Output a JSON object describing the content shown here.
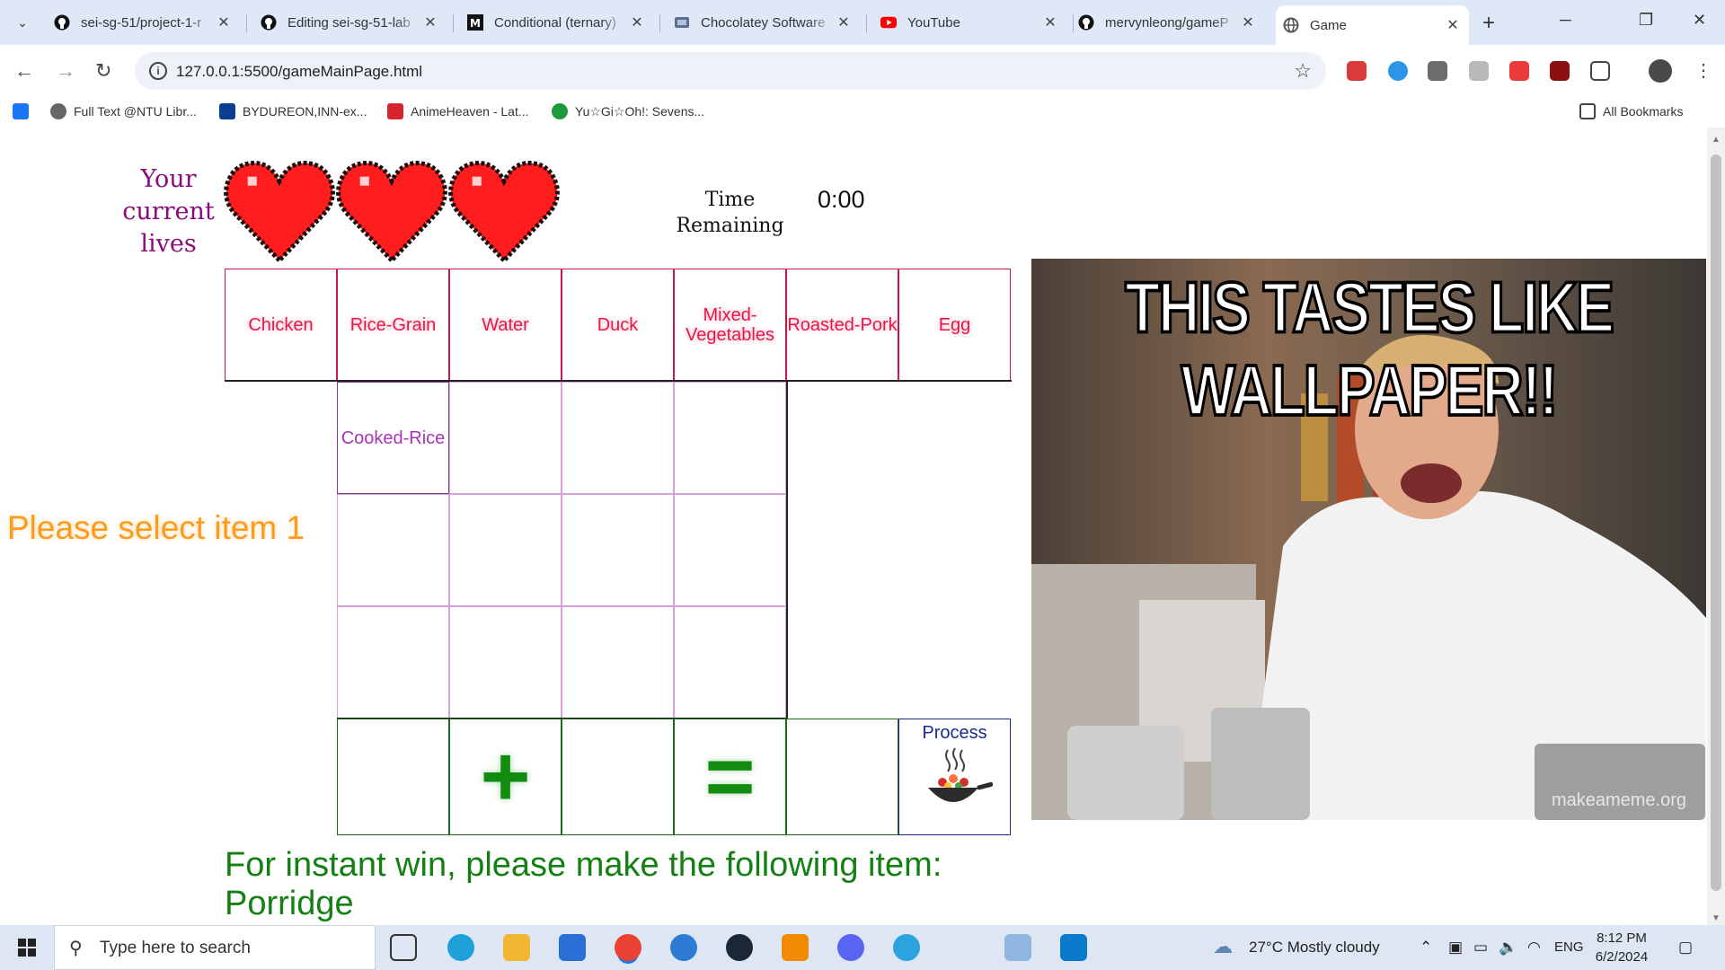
{
  "browser": {
    "tabs": [
      {
        "title": "sei-sg-51/project-1-r",
        "icon": "github-icon"
      },
      {
        "title": "Editing sei-sg-51-lab",
        "icon": "github-icon"
      },
      {
        "title": "Conditional (ternary)",
        "icon": "mdn-icon"
      },
      {
        "title": "Chocolatey Software",
        "icon": "chocolatey-icon"
      },
      {
        "title": "YouTube",
        "icon": "youtube-icon"
      },
      {
        "title": "mervynleong/gameP",
        "icon": "github-icon"
      },
      {
        "title": "Game",
        "icon": "globe-icon",
        "active": true
      }
    ],
    "url": "127.0.0.1:5500/gameMainPage.html",
    "bookmarks": [
      "Full Text @NTU Libr...",
      "BYDUREON,INN-ex...",
      "AnimeHeaven - Lat...",
      "Yu☆Gi☆Oh!: Sevens..."
    ],
    "all_bookmarks": "All Bookmarks"
  },
  "game": {
    "lives_label": "Your current lives",
    "lives": 3,
    "time_label": "Time Remaining",
    "time_value": "0:00",
    "ingredients": [
      "Chicken",
      "Rice-Grain",
      "Water",
      "Duck",
      "Mixed-Vegetables",
      "Roasted-Pork",
      "Egg"
    ],
    "made_items": [
      "Cooked-Rice"
    ],
    "operators": {
      "plus": "+",
      "equals": "="
    },
    "process_label": "Process",
    "prompt": "Please select item 1",
    "instant_win": "For instant win, please make the following item: Porridge"
  },
  "meme": {
    "caption": "THIS TASTES LIKE WALLPAPER!!",
    "watermark": "makeameme.org"
  },
  "taskbar": {
    "search_placeholder": "Type here to search",
    "weather": "27°C  Mostly cloudy",
    "language": "ENG",
    "time": "8:12 PM",
    "date": "6/2/2024"
  },
  "colors": {
    "lives_text": "#8b0a7c",
    "ingredient_text": "#e8174a",
    "made_text": "#a833b9",
    "operator": "#118c11",
    "prompt": "#ff9b1a",
    "instant_win": "#148014",
    "process": "#1b2a8c"
  }
}
